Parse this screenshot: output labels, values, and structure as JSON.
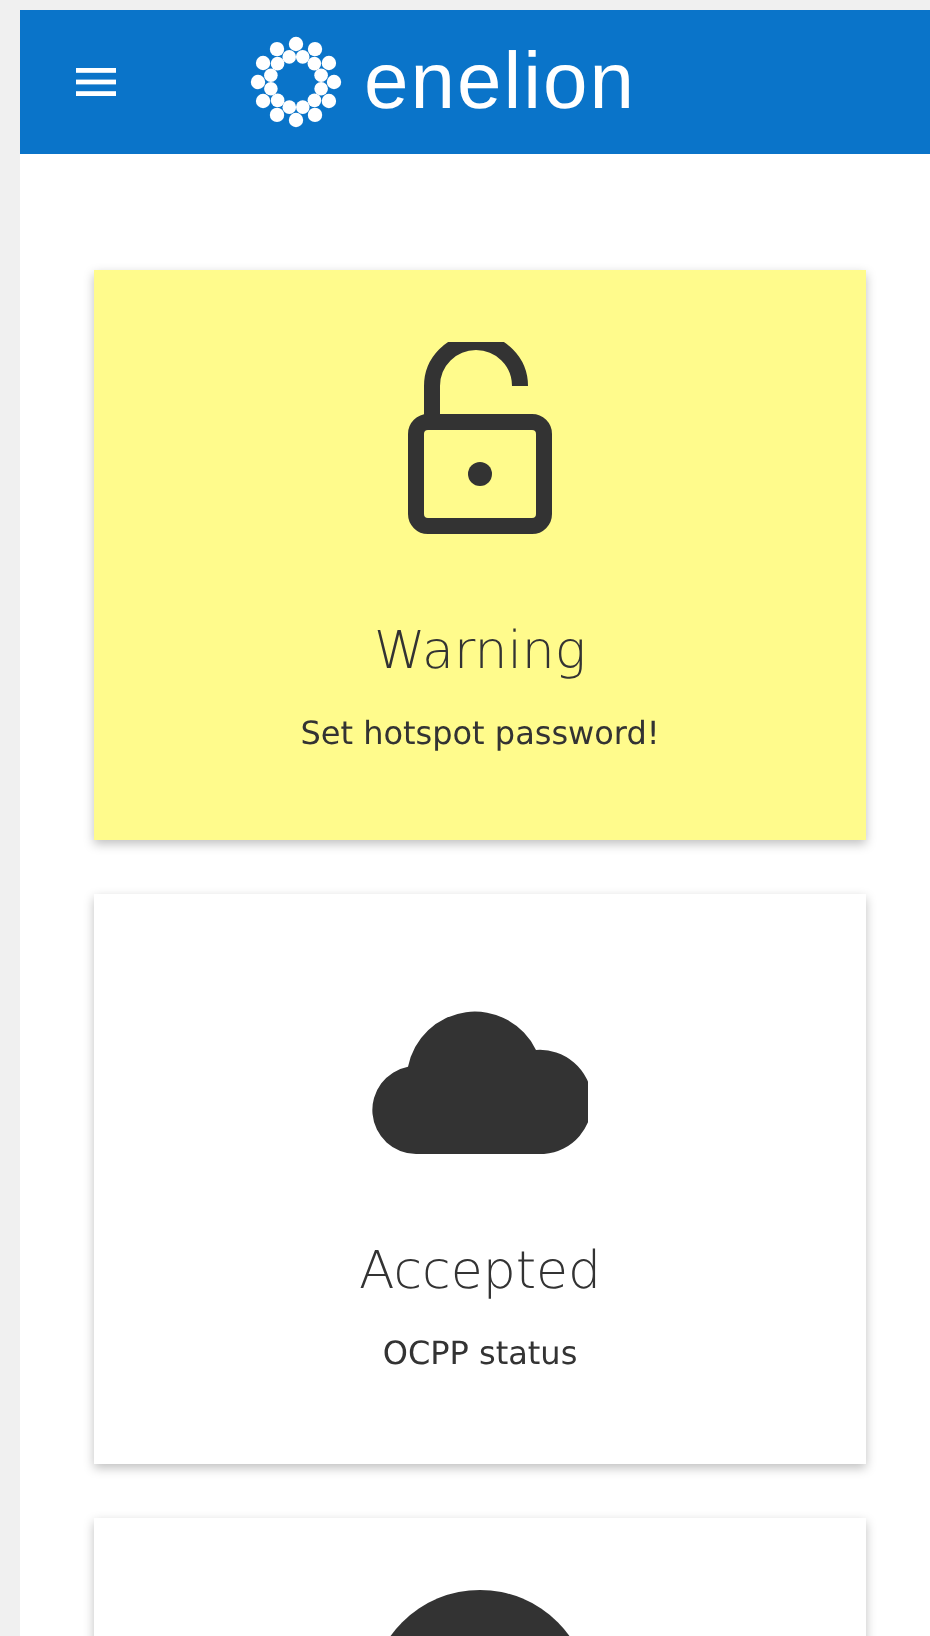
{
  "header": {
    "brand": "enelion"
  },
  "cards": [
    {
      "kind": "warning",
      "title": "Warning",
      "subtitle": "Set hotspot password!"
    },
    {
      "kind": "cloud",
      "title": "Accepted",
      "subtitle": "OCPP status"
    },
    {
      "kind": "round"
    }
  ]
}
